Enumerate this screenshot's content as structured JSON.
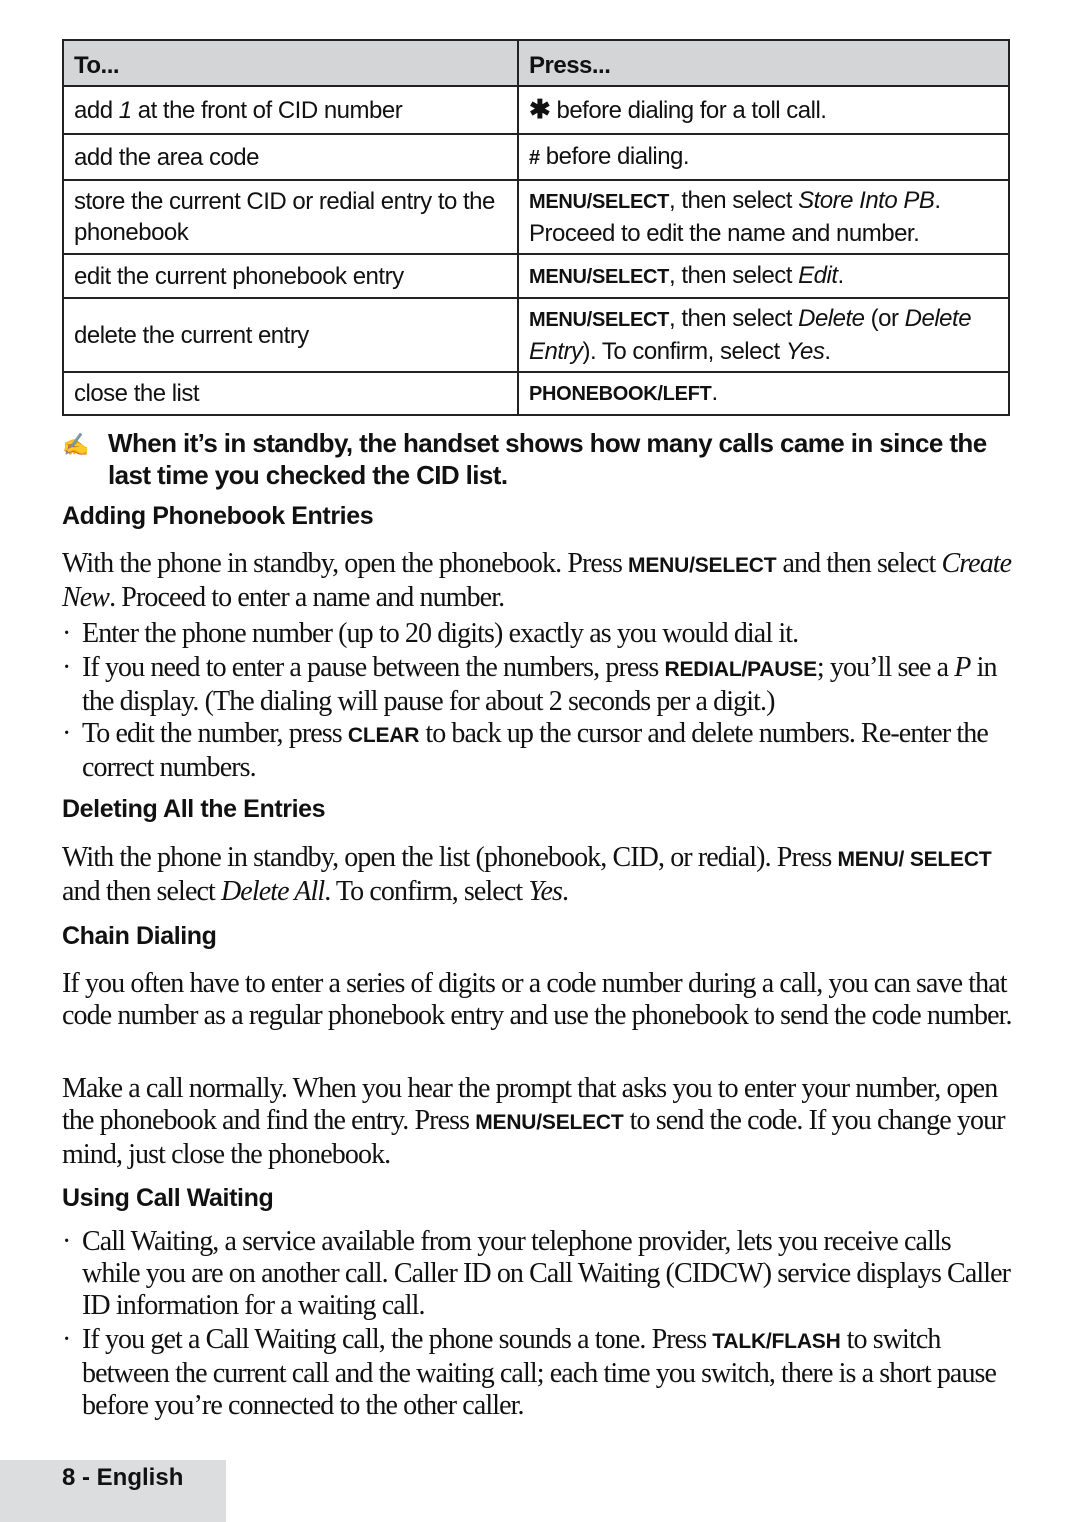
{
  "table": {
    "headers": [
      "To...",
      "Press..."
    ],
    "rows": [
      {
        "to": [
          "add ",
          "1",
          " at the front of CID number"
        ],
        "press": {
          "symbol": "✱",
          "text": " before dialing for a toll call."
        }
      },
      {
        "to": "add the area code",
        "press": {
          "symbol": "#",
          "text": " before dialing."
        }
      },
      {
        "to": "store the current CID or redial entry to the phonebook",
        "press": {
          "key": "MENU/SELECT",
          "text1": ", then select ",
          "italic1": "Store Into PB",
          "text2": ". Proceed to edit the name and number."
        }
      },
      {
        "to": "edit the current phonebook entry",
        "press": {
          "key": "MENU/SELECT",
          "text1": ", then select ",
          "italic1": "Edit",
          "text2": "."
        }
      },
      {
        "to": "delete the current entry",
        "press": {
          "key": "MENU/SELECT",
          "text1": ", then select ",
          "italic1": "Delete",
          "text2": " (or ",
          "italic2": "Delete Entry",
          "text3": "). To confirm, select ",
          "italic3": "Yes",
          "text4": "."
        }
      },
      {
        "to": "close the list",
        "press": {
          "key": "PHONEBOOK/LEFT",
          "text1": "."
        }
      }
    ]
  },
  "note": {
    "icon": "writing-hand-icon",
    "icon_glyph": "✍",
    "text": "When it’s in standby, the handset shows how many calls came in since the last time you checked the CID list."
  },
  "sections": {
    "adding": {
      "heading": "Adding Phonebook Entries",
      "intro": {
        "t1": "With the phone in standby, open the phonebook. Press ",
        "k1": "MENU/SELECT",
        "t2": " and then select ",
        "i1": "Create New",
        "t3": ". Proceed to enter a name and number."
      },
      "bullets": [
        {
          "t1": "Enter the phone number (up to 20 digits) exactly as you would dial it."
        },
        {
          "t1": "If you need to enter a pause between the numbers, press ",
          "k1": "REDIAL/PAUSE",
          "t2": "; you’ll see a ",
          "i1": "P",
          "t3": " in the display. (The dialing will pause for about 2 seconds per a digit.)"
        },
        {
          "t1": "To edit the number, press ",
          "k1": "CLEAR",
          "t2": " to back up the cursor and delete numbers. Re-enter the correct numbers."
        }
      ]
    },
    "deleting": {
      "heading": "Deleting All the Entries",
      "body": {
        "t1": "With the phone in standby, open the list (phonebook, CID, or redial). Press ",
        "k1": "MENU/ SELECT",
        "t2": " and then select ",
        "i1": "Delete All",
        "t3": ". To confirm, select ",
        "i2": "Yes",
        "t4": "."
      }
    },
    "chain": {
      "heading": "Chain Dialing",
      "p1": "If you often have to enter a series of digits or a code number during a call, you can save that code number as a regular phonebook entry and use the phonebook to send the code number.",
      "p2": {
        "t1": "Make a call normally. When you hear the prompt that asks you to enter your number, open the phonebook and find the entry. Press ",
        "k1": "MENU/SELECT",
        "t2": " to send the code. If you change your mind, just close the phonebook."
      }
    },
    "waiting": {
      "heading": "Using Call Waiting",
      "bullets": [
        {
          "t1": "Call Waiting, a service available from your telephone provider, lets you receive calls while you are on another call. Caller ID on Call Waiting (CIDCW) service displays Caller ID information for a waiting call."
        },
        {
          "t1": "If you get a Call Waiting call, the phone sounds a tone. Press ",
          "k1": "TALK/FLASH",
          "t2": " to switch between the current call and the waiting call; each time you switch, there is a short pause before you’re connected to the other caller."
        }
      ]
    }
  },
  "bullet_glyph": "·",
  "footer": {
    "page_label": "8 - English"
  }
}
